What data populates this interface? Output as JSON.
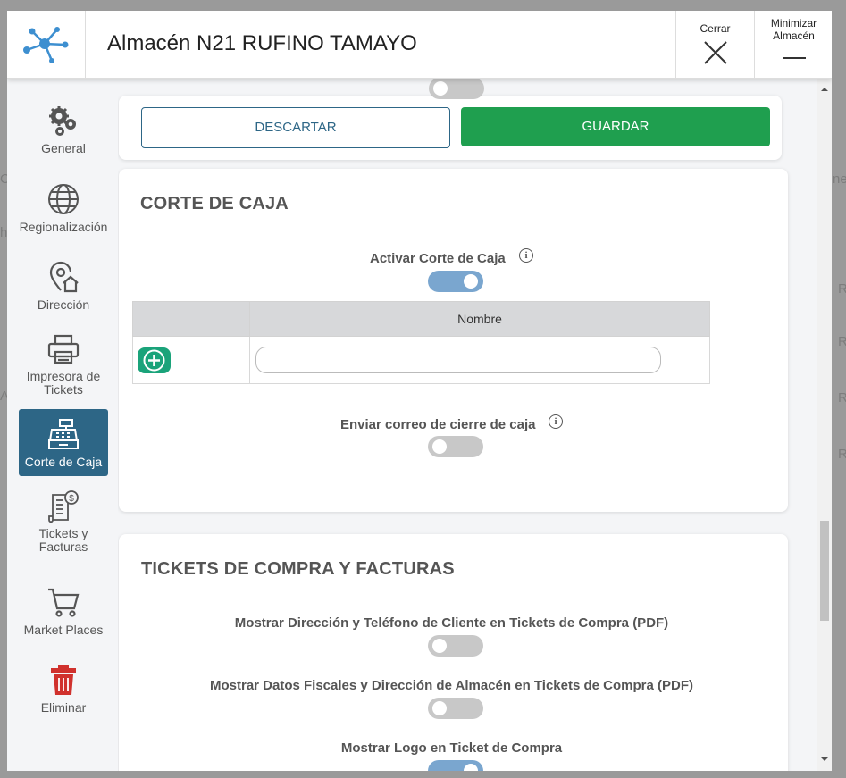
{
  "header": {
    "title": "Almacén N21 RUFINO TAMAYO",
    "close_label": "Cerrar",
    "minimize_label": "Minimizar Almacén"
  },
  "sidebar": {
    "items": [
      {
        "key": "general",
        "label": "General",
        "icon": "gears-icon"
      },
      {
        "key": "regionalizacion",
        "label": "Regionalización",
        "icon": "globe-icon"
      },
      {
        "key": "direccion",
        "label": "Dirección",
        "icon": "location-home-icon"
      },
      {
        "key": "impresora",
        "label": "Impresora de Tickets",
        "icon": "printer-icon"
      },
      {
        "key": "corte",
        "label": "Corte de Caja",
        "icon": "cash-register-icon",
        "active": true
      },
      {
        "key": "tickets",
        "label": "Tickets y Facturas",
        "icon": "invoice-icon"
      },
      {
        "key": "market",
        "label": "Market Places",
        "icon": "cart-icon"
      },
      {
        "key": "eliminar",
        "label": "Eliminar",
        "icon": "trash-icon"
      }
    ]
  },
  "actions": {
    "discard_label": "DESCARTAR",
    "save_label": "GUARDAR"
  },
  "corte_caja": {
    "title": "CORTE DE CAJA",
    "activar_label": "Activar Corte de Caja",
    "activar_on": true,
    "table_header": "Nombre",
    "name_input_value": "",
    "enviar_correo_label": "Enviar correo de cierre de caja",
    "enviar_correo_on": false
  },
  "tickets_facturas": {
    "title": "TICKETS DE COMPRA Y FACTURAS",
    "options": [
      {
        "label": "Mostrar Dirección y Teléfono de Cliente en Tickets de Compra (PDF)",
        "on": false
      },
      {
        "label": "Mostrar Datos Fiscales y Dirección de Almacén en Tickets de Compra (PDF)",
        "on": false
      },
      {
        "label": "Mostrar Logo en Ticket de Compra",
        "on": true
      }
    ]
  },
  "colors": {
    "accent": "#2d6686",
    "save_green": "#1f9f4f",
    "toggle_on": "#7aa6cf",
    "toggle_off": "#c8c8c8",
    "add_button": "#1aa37a",
    "trash_red": "#d0312d"
  }
}
